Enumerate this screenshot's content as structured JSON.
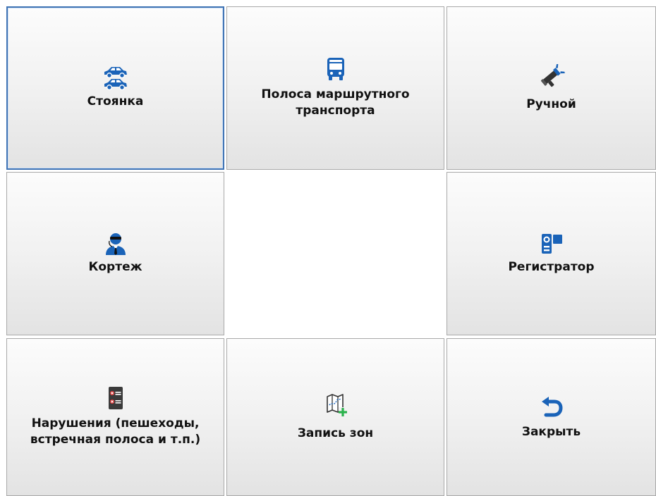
{
  "tiles": {
    "parking": {
      "label": "Стоянка",
      "icon": "cars-icon"
    },
    "bus_lane": {
      "label": "Полоса маршрутного\nтранспорта",
      "icon": "bus-icon"
    },
    "manual": {
      "label": "Ручной",
      "icon": "radar-gun-icon"
    },
    "motorcade": {
      "label": "Кортеж",
      "icon": "agent-icon"
    },
    "recorder": {
      "label": "Регистратор",
      "icon": "camcorder-icon"
    },
    "violations": {
      "label": "Нарушения (пешеходы,\nвстречная полоса и т.п.)",
      "icon": "violations-list-icon"
    },
    "zone_record": {
      "label": "Запись зон",
      "icon": "map-add-icon"
    },
    "close": {
      "label": "Закрыть",
      "icon": "back-arrow-icon"
    }
  },
  "colors": {
    "icon_blue": "#1a63b8",
    "accent_green": "#2bb24c",
    "danger_red": "#e03131",
    "dark_icon": "#333333"
  }
}
